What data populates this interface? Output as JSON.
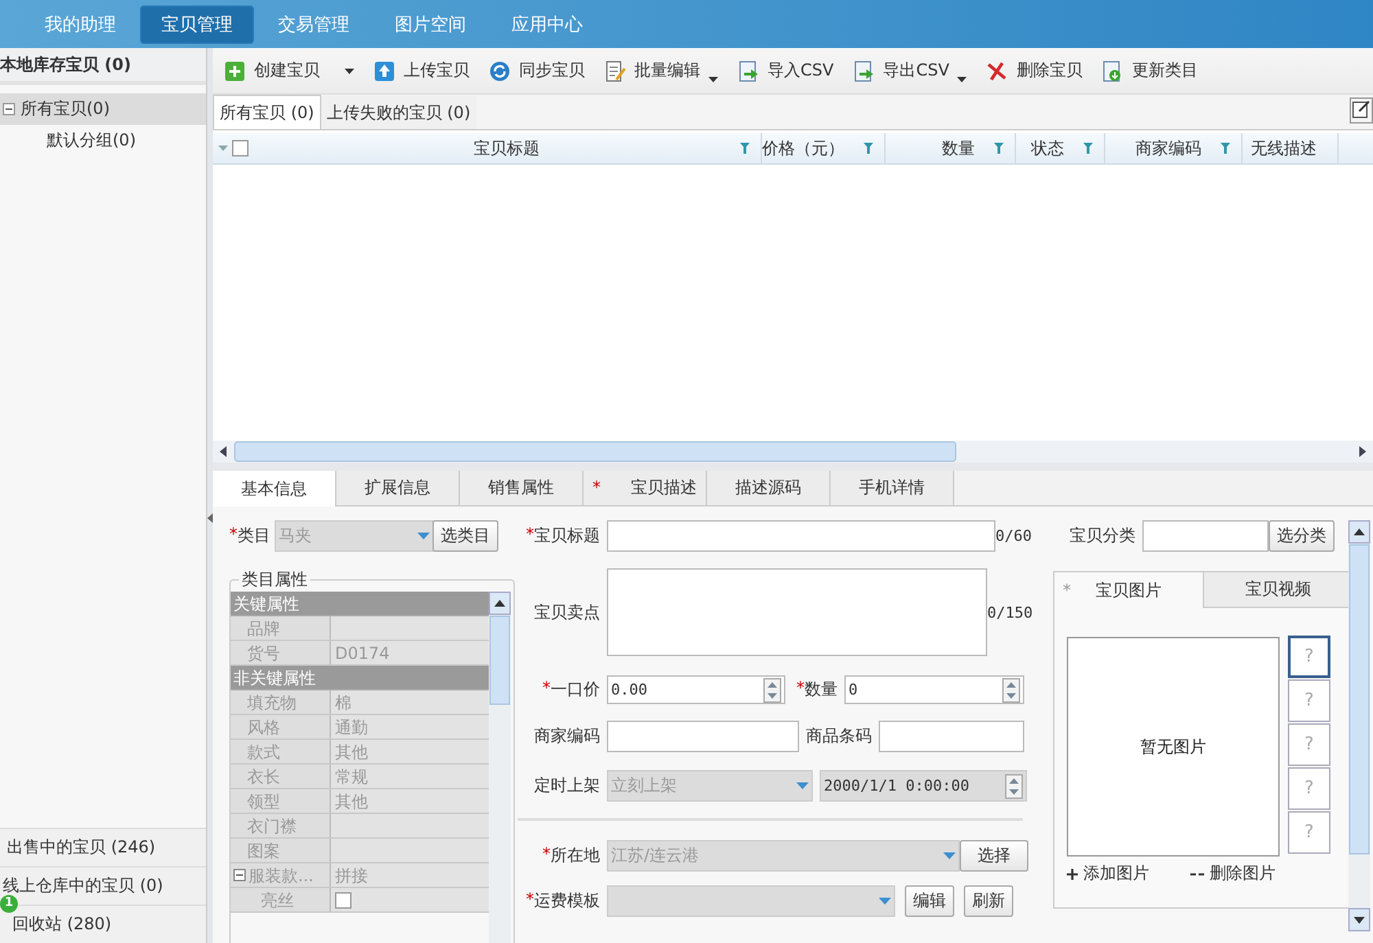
{
  "nav": {
    "tabs": [
      {
        "label": "我的助理",
        "selected": false
      },
      {
        "label": "宝贝管理",
        "selected": true
      },
      {
        "label": "交易管理",
        "selected": false
      },
      {
        "label": "图片空间",
        "selected": false
      },
      {
        "label": "应用中心",
        "selected": false
      }
    ]
  },
  "sidebar": {
    "title": "本地库存宝贝 (0)",
    "tree": [
      {
        "label": "所有宝贝(0)",
        "selected": true,
        "expanded": true,
        "children": [
          {
            "label": "默认分组(0)",
            "selected": false
          }
        ]
      }
    ],
    "sections": [
      {
        "label": "出售中的宝贝 (246)"
      },
      {
        "label": "线上仓库中的宝贝 (0)"
      },
      {
        "label": "回收站 (280)"
      }
    ],
    "badge": "1"
  },
  "toolbar": [
    {
      "label": "创建宝贝",
      "menu": true
    },
    {
      "label": "上传宝贝",
      "menu": false
    },
    {
      "label": "同步宝贝",
      "menu": false
    },
    {
      "label": "批量编辑",
      "menu": true
    },
    {
      "label": "导入CSV",
      "menu": false
    },
    {
      "label": "导出CSV",
      "menu": true
    },
    {
      "label": "删除宝贝",
      "menu": false
    },
    {
      "label": "更新类目",
      "menu": false
    }
  ],
  "list_tabs": [
    {
      "label": "所有宝贝 (0)",
      "selected": true
    },
    {
      "label": "上传失败的宝贝 (0)",
      "selected": false
    }
  ],
  "table": {
    "select_all": false,
    "columns": [
      {
        "label": "宝贝标题",
        "filter": true
      },
      {
        "label": "价格（元）",
        "filter": true
      },
      {
        "label": "数量",
        "filter": true
      },
      {
        "label": "状态",
        "filter": true
      },
      {
        "label": "商家编码",
        "filter": true
      },
      {
        "label": "无线描述",
        "filter": false
      }
    ]
  },
  "detail_tabs": [
    {
      "label": "基本信息",
      "selected": true
    },
    {
      "label": "扩展信息",
      "selected": false
    },
    {
      "label": "销售属性",
      "selected": false
    },
    {
      "label": "宝贝描述",
      "selected": false,
      "required_mark": "*"
    },
    {
      "label": "描述源码",
      "selected": false
    },
    {
      "label": "手机详情",
      "selected": false
    }
  ],
  "category": {
    "label": "类目",
    "required_mark": "*",
    "value": "马夹",
    "disabled": true,
    "button": "选类目"
  },
  "attributes": {
    "legend": "类目属性",
    "rows": [
      {
        "kind": "group",
        "label": "关键属性"
      },
      {
        "kind": "attr",
        "name": "品牌"
      },
      {
        "kind": "attr",
        "name": "货号",
        "value": "D0174"
      },
      {
        "kind": "group",
        "label": "非关键属性"
      },
      {
        "kind": "attr",
        "name": "填充物",
        "value": "棉"
      },
      {
        "kind": "attr",
        "name": "风格",
        "value": "通勤"
      },
      {
        "kind": "attr",
        "name": "款式",
        "value": "其他"
      },
      {
        "kind": "attr",
        "name": "衣长",
        "value": "常规"
      },
      {
        "kind": "attr",
        "name": "领型",
        "value": "其他"
      },
      {
        "kind": "attr",
        "name": "衣门襟"
      },
      {
        "kind": "attr",
        "name": "图案"
      },
      {
        "kind": "attr",
        "name": "服装款...",
        "value": "拼接",
        "expanded": true,
        "children": [
          {
            "kind": "check",
            "name": "亮丝",
            "checked": false
          }
        ]
      }
    ]
  },
  "form": {
    "title": {
      "label": "宝贝标题",
      "required_mark": "*",
      "counter": "0/60"
    },
    "selling_points": {
      "label": "宝贝卖点",
      "counter": "0/150"
    },
    "price": {
      "label": "一口价",
      "required_mark": "*",
      "value": "0.00"
    },
    "quantity": {
      "label": "数量",
      "required_mark": "*",
      "value": "0"
    },
    "merchant_code": {
      "label": "商家编码"
    },
    "barcode": {
      "label": "商品条码"
    },
    "schedule": {
      "label": "定时上架",
      "value": "立刻上架",
      "datetime": "2000/1/1 0:00:00",
      "disabled": true
    },
    "location": {
      "label": "所在地",
      "required_mark": "*",
      "value": "江苏/连云港",
      "disabled": true,
      "button": "选择"
    },
    "shipping": {
      "label": "运费模板",
      "required_mark": "*",
      "disabled": true,
      "buttons": [
        "编辑",
        "刷新"
      ]
    }
  },
  "item_category": {
    "label": "宝贝分类",
    "button": "选分类"
  },
  "media_tabs": [
    {
      "label": "宝贝图片",
      "selected": true,
      "required_mark": "*"
    },
    {
      "label": "宝贝视频",
      "selected": false
    }
  ],
  "images": {
    "empty_text": "暂无图片",
    "thumbs": [
      {
        "label": "?",
        "selected": true
      },
      {
        "label": "?",
        "selected": false
      },
      {
        "label": "?",
        "selected": false
      },
      {
        "label": "?",
        "selected": false
      },
      {
        "label": "?",
        "selected": false
      }
    ],
    "add": "添加图片",
    "remove": "删除图片"
  }
}
